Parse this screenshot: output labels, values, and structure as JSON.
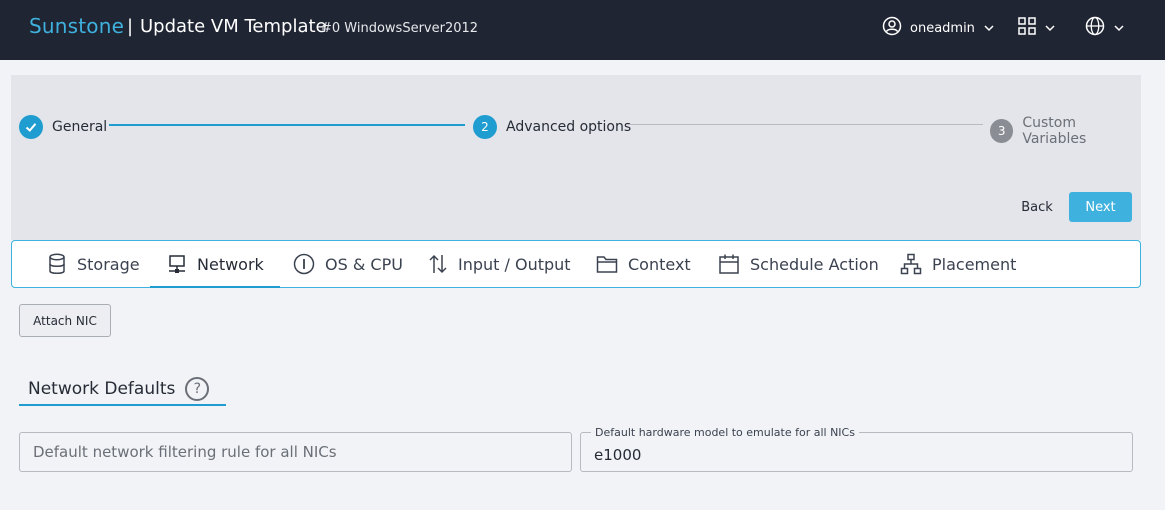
{
  "header": {
    "brand": "Sunstone",
    "separator": "|",
    "title": "Update VM Template",
    "subtitle": "#0 WindowsServer2012",
    "user": "oneadmin"
  },
  "stepper": {
    "steps": [
      {
        "label": "General",
        "number": "1",
        "state": "done"
      },
      {
        "label": "Advanced options",
        "number": "2",
        "state": "active"
      },
      {
        "label": "Custom Variables",
        "number": "3",
        "state": "pending"
      }
    ],
    "back_label": "Back",
    "next_label": "Next"
  },
  "tabs": [
    {
      "label": "Storage",
      "icon": "database-icon"
    },
    {
      "label": "Network",
      "icon": "network-icon",
      "active": true
    },
    {
      "label": "OS & CPU",
      "icon": "info-icon"
    },
    {
      "label": "Input / Output",
      "icon": "arrows-updown-icon"
    },
    {
      "label": "Context",
      "icon": "folder-icon"
    },
    {
      "label": "Schedule Action",
      "icon": "calendar-icon"
    },
    {
      "label": "Placement",
      "icon": "hierarchy-icon"
    }
  ],
  "network": {
    "attach_label": "Attach NIC",
    "section_title": "Network Defaults",
    "help_glyph": "?",
    "filter_placeholder": "Default network filtering rule for all NICs",
    "filter_value": "",
    "model_label": "Default hardware model to emulate for all NICs",
    "model_value": "e1000"
  },
  "colors": {
    "accent": "#1f9cd0",
    "brand": "#3fb1de",
    "topbar": "#1f2532",
    "pending": "#8a8d93"
  }
}
